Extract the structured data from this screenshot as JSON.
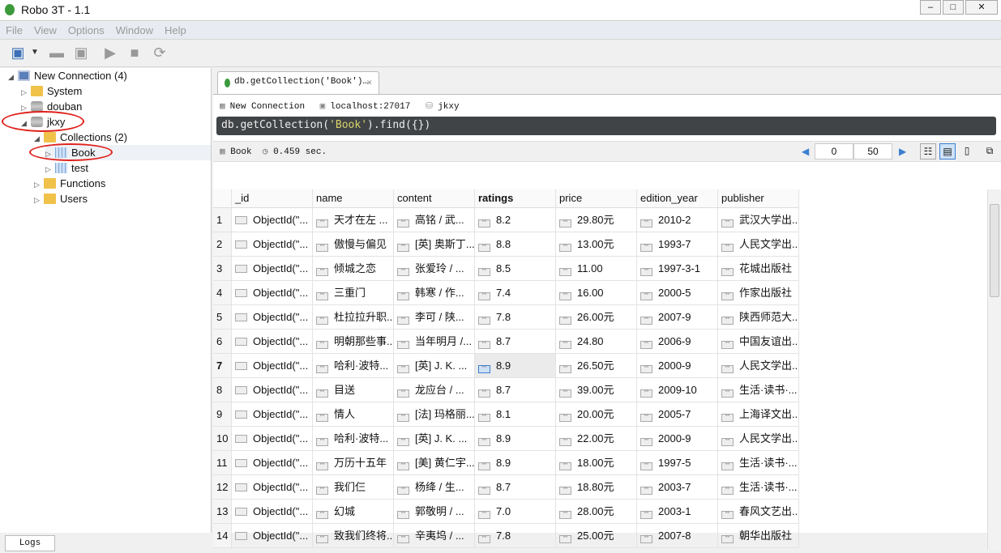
{
  "window": {
    "title": "Robo 3T - 1.1"
  },
  "menu": [
    "File",
    "View",
    "Options",
    "Window",
    "Help"
  ],
  "tree": {
    "connection": "New Connection (4)",
    "items": [
      {
        "label": "System",
        "icon": "folder-icon"
      },
      {
        "label": "douban",
        "icon": "database-icon"
      },
      {
        "label": "jkxy",
        "icon": "database-icon"
      },
      {
        "label": "Collections (2)",
        "icon": "folder-icon"
      },
      {
        "label": "Book",
        "icon": "collection-icon"
      },
      {
        "label": "test",
        "icon": "collection-icon"
      },
      {
        "label": "Functions",
        "icon": "folder-icon"
      },
      {
        "label": "Users",
        "icon": "folder-icon"
      }
    ]
  },
  "tab": {
    "label": "db.getCollection('Book')…"
  },
  "info": {
    "connection": "New Connection",
    "host": "localhost:27017",
    "database": "jkxy"
  },
  "query": {
    "prefix": "db.getCollection(",
    "arg": "'Book'",
    "suffix": ").find({})"
  },
  "results": {
    "collection": "Book",
    "time": "0.459 sec.",
    "skip": "0",
    "limit": "50"
  },
  "table": {
    "columns": [
      "_id",
      "name",
      "content",
      "ratings",
      "price",
      "edition_year",
      "publisher"
    ],
    "rows": [
      [
        "1",
        "ObjectId(\"...",
        "天才在左 ...",
        "高铭 / 武...",
        "8.2",
        "29.80元",
        "2010-2",
        "武汉大学出..."
      ],
      [
        "2",
        "ObjectId(\"...",
        "傲慢与偏见",
        "[英] 奥斯丁...",
        "8.8",
        "13.00元",
        "1993-7",
        "人民文学出..."
      ],
      [
        "3",
        "ObjectId(\"...",
        "倾城之恋",
        "张爱玲 / ...",
        "8.5",
        "11.00",
        "1997-3-1",
        "花城出版社"
      ],
      [
        "4",
        "ObjectId(\"...",
        "三重门",
        "韩寒 / 作...",
        "7.4",
        "16.00",
        "2000-5",
        "作家出版社"
      ],
      [
        "5",
        "ObjectId(\"...",
        "杜拉拉升职...",
        "李可 / 陕...",
        "7.8",
        "26.00元",
        "2007-9",
        "陕西师范大..."
      ],
      [
        "6",
        "ObjectId(\"...",
        "明朝那些事...",
        "当年明月 /...",
        "8.7",
        "24.80",
        "2006-9",
        "中国友谊出..."
      ],
      [
        "7",
        "ObjectId(\"...",
        "哈利·波特...",
        "[英] J. K. ...",
        "8.9",
        "26.50元",
        "2000-9",
        "人民文学出..."
      ],
      [
        "8",
        "ObjectId(\"...",
        "目送",
        "龙应台 / ...",
        "8.7",
        "39.00元",
        "2009-10",
        "生活·读书·..."
      ],
      [
        "9",
        "ObjectId(\"...",
        "情人",
        "[法] 玛格丽...",
        "8.1",
        "20.00元",
        "2005-7",
        "上海译文出..."
      ],
      [
        "10",
        "ObjectId(\"...",
        "哈利·波特...",
        "[英] J. K. ...",
        "8.9",
        "22.00元",
        "2000-9",
        "人民文学出..."
      ],
      [
        "11",
        "ObjectId(\"...",
        "万历十五年",
        "[美] 黄仁宇...",
        "8.9",
        "18.00元",
        "1997-5",
        "生活·读书·..."
      ],
      [
        "12",
        "ObjectId(\"...",
        "我们仨",
        "杨绛 / 生...",
        "8.7",
        "18.80元",
        "2003-7",
        "生活·读书·..."
      ],
      [
        "13",
        "ObjectId(\"...",
        "幻城",
        "郭敬明 / ...",
        "7.0",
        "28.00元",
        "2003-1",
        "春风文艺出..."
      ],
      [
        "14",
        "ObjectId(\"...",
        "致我们终将...",
        "辛夷坞 / ...",
        "7.8",
        "25.00元",
        "2007-8",
        "朝华出版社"
      ]
    ]
  },
  "bottom": {
    "logs": "Logs"
  }
}
